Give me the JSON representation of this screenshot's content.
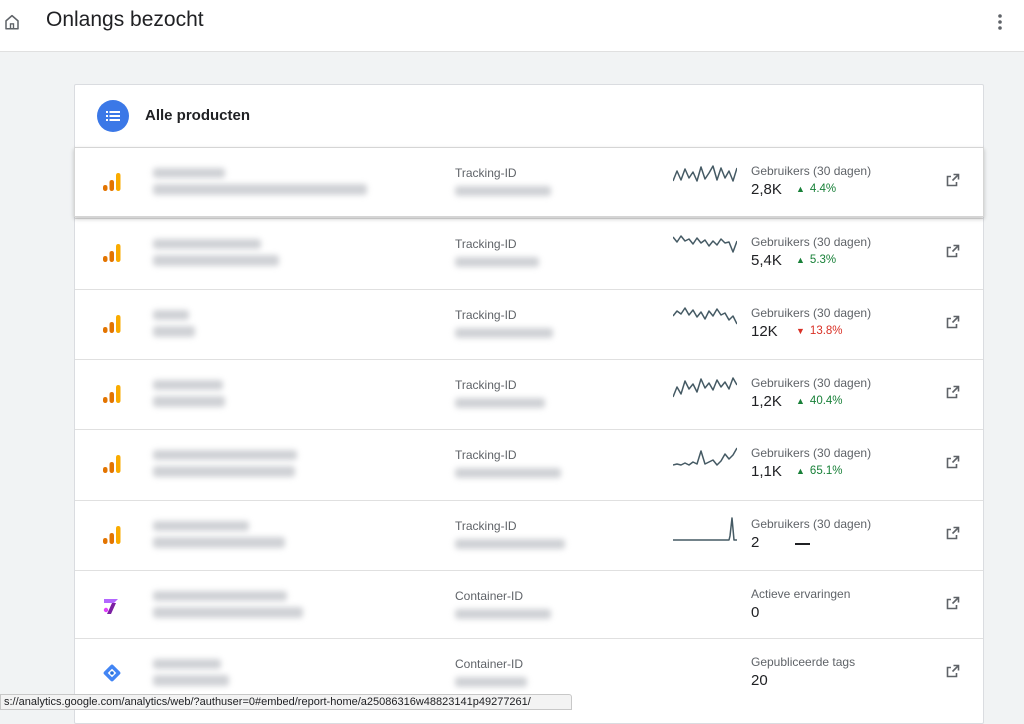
{
  "header": {
    "title": "Onlangs bezocht",
    "home_icon": "home-icon",
    "more_icon": "more-vert-icon"
  },
  "card": {
    "title": "Alle producten",
    "icon": "list-icon"
  },
  "rows": [
    {
      "product": "analytics",
      "id_label": "Tracking-ID",
      "metric_label": "Gebruikers (30 dagen)",
      "value": "2,8K",
      "change": "4.4%",
      "direction": "up"
    },
    {
      "product": "analytics",
      "id_label": "Tracking-ID",
      "metric_label": "Gebruikers (30 dagen)",
      "value": "5,4K",
      "change": "5.3%",
      "direction": "up"
    },
    {
      "product": "analytics",
      "id_label": "Tracking-ID",
      "metric_label": "Gebruikers (30 dagen)",
      "value": "12K",
      "change": "13.8%",
      "direction": "down"
    },
    {
      "product": "analytics",
      "id_label": "Tracking-ID",
      "metric_label": "Gebruikers (30 dagen)",
      "value": "1,2K",
      "change": "40.4%",
      "direction": "up"
    },
    {
      "product": "analytics",
      "id_label": "Tracking-ID",
      "metric_label": "Gebruikers (30 dagen)",
      "value": "1,1K",
      "change": "65.1%",
      "direction": "up"
    },
    {
      "product": "analytics",
      "id_label": "Tracking-ID",
      "metric_label": "Gebruikers (30 dagen)",
      "value": "2",
      "change": "",
      "direction": "none"
    },
    {
      "product": "optimize",
      "id_label": "Container-ID",
      "metric_label": "Actieve ervaringen",
      "value": "0",
      "change": "",
      "direction": "none"
    },
    {
      "product": "tag-manager",
      "id_label": "Container-ID",
      "metric_label": "Gepubliceerde tags",
      "value": "20",
      "change": "",
      "direction": "none"
    }
  ],
  "colors": {
    "accent": "#3b78e7",
    "up": "#188038",
    "down": "#d93025",
    "analytics_dark": "#e37400",
    "analytics_light": "#f9ab00",
    "sparkline": "#455a64"
  },
  "status_bar": {
    "url": "s://analytics.google.com/analytics/web/?authuser=0#embed/report-home/a25086316w48823141p49277261/"
  }
}
